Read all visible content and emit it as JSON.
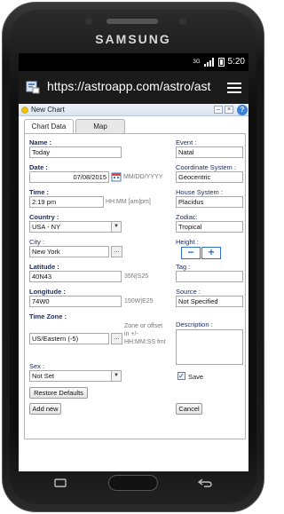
{
  "device": {
    "brand": "SAMSUNG"
  },
  "statusbar": {
    "time": "5:20",
    "network": "3G"
  },
  "browser": {
    "url": "https://astroapp.com/astro/ast"
  },
  "dialog": {
    "title": "New Chart",
    "window_buttons": [
      "–",
      "×",
      "?"
    ],
    "tabs": [
      {
        "label": "Chart Data",
        "active": true
      },
      {
        "label": "Map",
        "active": false
      }
    ],
    "name": {
      "label": "Name :",
      "value": "Today"
    },
    "date": {
      "label": "Date :",
      "value": "07/08/2015",
      "hint": "MM/DD/YYYY"
    },
    "time": {
      "label": "Time :",
      "value": "2:19 pm",
      "hint": "HH:MM [am|pm]"
    },
    "country": {
      "label": "Country :",
      "value": "USA - NY"
    },
    "city": {
      "label": "City :",
      "value": "New York",
      "button": "..."
    },
    "latitude": {
      "label": "Latitude :",
      "value": "40N43",
      "hint": "35N|S25"
    },
    "longitude": {
      "label": "Longitude :",
      "value": "74W0",
      "hint": "150W|E25"
    },
    "timezone": {
      "label": "Time Zone :",
      "value": "US/Eastern (-5)",
      "button": "...",
      "hint": "Zone or offset in +/- HH:MM:SS fmt"
    },
    "sex": {
      "label": "Sex :",
      "value": "Not Set"
    },
    "event": {
      "label": "Event :",
      "value": "Natal"
    },
    "coordinate_system": {
      "label": "Coordinate System :",
      "value": "Geocentric"
    },
    "house_system": {
      "label": "House System :",
      "value": "Placidus"
    },
    "zodiac": {
      "label": "Zodiac:",
      "value": "Tropical"
    },
    "height": {
      "label": "Height :",
      "minus": "−",
      "plus": "+"
    },
    "tag": {
      "label": "Tag :",
      "value": ""
    },
    "source": {
      "label": "Source :",
      "value": "Not Specified"
    },
    "description": {
      "label": "Description :",
      "value": ""
    },
    "save": {
      "label": "Save",
      "checked": true
    },
    "restore_defaults": "Restore Defaults",
    "add_new": "Add new",
    "cancel": "Cancel"
  }
}
